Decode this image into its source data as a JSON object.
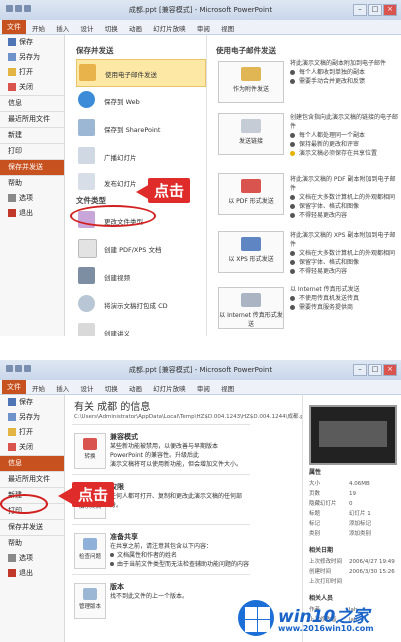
{
  "panel1": {
    "window_title": "成都.ppt [兼容模式] - Microsoft PowerPoint",
    "ribbon": {
      "file_tab": "文件",
      "tabs": [
        "开始",
        "插入",
        "设计",
        "切换",
        "动画",
        "幻灯片放映",
        "审阅",
        "视图"
      ]
    },
    "nav": [
      "保存",
      "另存为",
      "打开",
      "关闭",
      "信息",
      "最近所用文件",
      "新建",
      "打印",
      "保存并发送",
      "帮助",
      "选项",
      "退出"
    ],
    "nav_active": "保存并发送",
    "save_send_heading": "保存并发送",
    "save_send_options": [
      {
        "label": "使用电子邮件发送",
        "icon": "email-icon"
      },
      {
        "label": "保存到 Web",
        "icon": "web-icon"
      },
      {
        "label": "保存到 SharePoint",
        "icon": "sharepoint-icon"
      },
      {
        "label": "广播幻灯片",
        "icon": "broadcast-icon"
      },
      {
        "label": "发布幻灯片",
        "icon": "publish-icon"
      }
    ],
    "file_types_heading": "文件类型",
    "file_types_options": [
      {
        "label": "更改文件类型",
        "icon": "change-type-icon"
      },
      {
        "label": "创建 PDF/XPS 文档",
        "icon": "pdf-icon"
      },
      {
        "label": "创建视频",
        "icon": "video-icon"
      },
      {
        "label": "将演示文稿打包成 CD",
        "icon": "cd-icon"
      },
      {
        "label": "创建讲义",
        "icon": "handout-icon"
      }
    ],
    "email_heading": "使用电子邮件发送",
    "email_buttons": [
      {
        "label": "作为附件发送",
        "desc": [
          "将此演示文稿的副本附加到电子邮件",
          "每个人都收到单独的副本",
          "需要手动合并更改和反馈"
        ]
      },
      {
        "label": "发送链接",
        "desc": [
          "创建包含指向此演示文稿的链接的电子邮件",
          "每个人都处理同一个副本",
          "保持最新的更改和评审",
          "演示文稿必须保存在共享位置"
        ]
      },
      {
        "label": "以 PDF 形式发送",
        "desc": [
          "将此演示文稿的 PDF 副本附加到电子邮件",
          "文档在大多数计算机上的外观都相同",
          "保留字体、格式和图像",
          "不得轻易更改内容"
        ]
      },
      {
        "label": "以 XPS 形式发送",
        "desc": [
          "将此演示文稿的 XPS 副本附加到电子邮件",
          "文档在大多数计算机上的外观都相同",
          "保留字体、格式和图像",
          "不得轻易更改内容"
        ]
      },
      {
        "label": "以 Internet 传真形式发送",
        "desc": [
          "以 Internet 传真形式发送",
          "不使用传真机发送传真",
          "需要传真服务提供商"
        ]
      }
    ],
    "callout": "点击"
  },
  "panel2": {
    "window_title": "成都.ppt [兼容模式] - Microsoft PowerPoint",
    "ribbon": {
      "file_tab": "文件",
      "tabs": [
        "开始",
        "插入",
        "设计",
        "切换",
        "动画",
        "幻灯片放映",
        "审阅",
        "视图"
      ]
    },
    "nav": [
      "保存",
      "另存为",
      "打开",
      "关闭",
      "信息",
      "最近所用文件",
      "新建",
      "打印",
      "保存并发送",
      "帮助",
      "选项",
      "退出"
    ],
    "nav_active": "信息",
    "info_title": "有关 成都 的信息",
    "info_path": "C:\\Users\\Administrator\\AppData\\Local\\Temp\\HZ$D.004.1243\\HZ$D.004.1244\\成都.ppt",
    "sections": [
      {
        "button": "转换",
        "title": "兼容模式",
        "text": [
          "某些新功能被禁用，以便改善与早期版本 PowerPoint 的兼容性。升级后此",
          "演示文稿将可以使用新功能，但会增加文件大小。"
        ]
      },
      {
        "button": "演示文稿",
        "title": "权限",
        "text": [
          "任何人都可打开、复制和更改此演示文稿的任何部分。"
        ]
      },
      {
        "button": "检查问题",
        "title": "准备共享",
        "text": [
          "在共享之前，请注意其包含以下内容：",
          "文档属性和作者的姓名",
          "由于当前文件类型而无法检查辅助功能问题的内容"
        ]
      },
      {
        "button": "管理版本",
        "title": "版本",
        "text": [
          "找不到此文件的上一个版本。"
        ]
      }
    ],
    "props": {
      "heading": "属性",
      "rows": [
        [
          "大小",
          "4.06MB"
        ],
        [
          "页数",
          "19"
        ],
        [
          "隐藏幻灯片",
          "0"
        ],
        [
          "标题",
          "幻灯片 1"
        ],
        [
          "标记",
          "添加标记"
        ],
        [
          "类别",
          "添加类别"
        ]
      ],
      "dates_heading": "相关日期",
      "dates": [
        [
          "上次修改时间",
          "2006/4/27 19:49"
        ],
        [
          "创建时间",
          "2006/3/30 15:26"
        ],
        [
          "上次打印时间",
          ""
        ]
      ],
      "people_heading": "相关人员",
      "people": [
        [
          "作者",
          "lah"
        ],
        [
          "上次修改者",
          "lah"
        ]
      ]
    },
    "callout": "点击",
    "watermark": {
      "brand": "win10之家",
      "url": "www.2016win10.com"
    }
  },
  "colors": {
    "accent": "#c7511f",
    "callout": "#e02b2b",
    "selected": "#fde9a5"
  }
}
